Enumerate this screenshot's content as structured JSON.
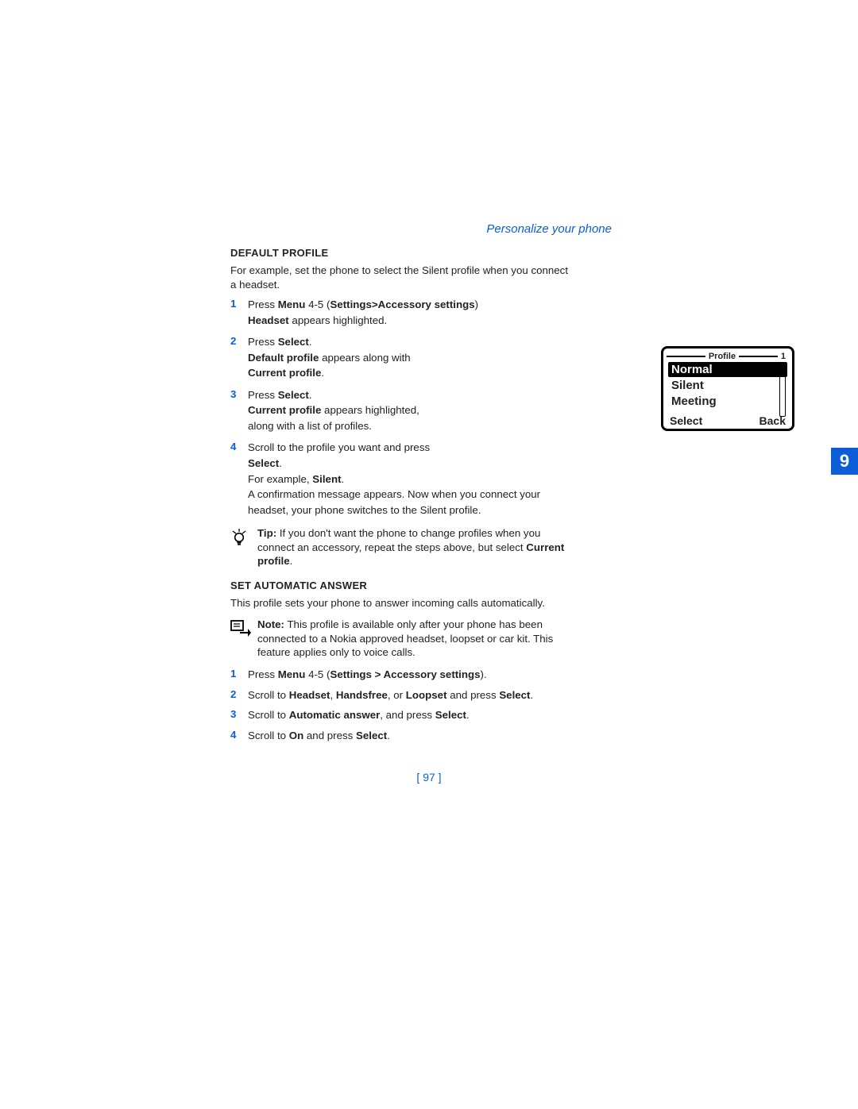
{
  "header": {
    "chapter_title": "Personalize your phone"
  },
  "section_tab": "9",
  "default_profile": {
    "heading": "DEFAULT PROFILE",
    "intro_a": "For example, set the phone to select the Silent profile when you connect",
    "intro_b": "a headset.",
    "steps": {
      "s1": {
        "num": "1",
        "t1a": "Press ",
        "t1b": "Menu",
        "t1c": " 4-5 (",
        "t1d": "Settings>Accessory settings",
        "t1e": ")",
        "t2a": "Headset",
        "t2b": " appears highlighted."
      },
      "s2": {
        "num": "2",
        "t1a": "Press ",
        "t1b": "Select",
        "t1c": ".",
        "t2a": "Default profile",
        "t2b": " appears along with",
        "t3a": "Current profile",
        "t3b": "."
      },
      "s3": {
        "num": "3",
        "t1a": "Press ",
        "t1b": "Select",
        "t1c": ".",
        "t2a": "Current profile",
        "t2b": " appears highlighted,",
        "t3": "along with a list of profiles."
      },
      "s4": {
        "num": "4",
        "t1": "Scroll to the profile you want and press",
        "t2": "Select",
        "t2b": ".",
        "t3a": "For example, ",
        "t3b": "Silent",
        "t3c": ".",
        "t4": "A confirmation message appears. Now when you connect your",
        "t5": "headset, your phone switches to the Silent profile."
      }
    },
    "tip": {
      "lead": "Tip:",
      "t1": " If you don't want the phone to change profiles when you",
      "t2a": "connect an accessory, repeat the steps above, but select ",
      "t2b": "Current",
      "t3a": "profile",
      "t3b": "."
    }
  },
  "phone_screen": {
    "title": "Profile",
    "page": "1",
    "items": {
      "i0": "Normal",
      "i1": "Silent",
      "i2": "Meeting"
    },
    "soft_left": "Select",
    "soft_right": "Back"
  },
  "auto_answer": {
    "heading": "SET AUTOMATIC ANSWER",
    "intro": "This profile sets your phone to answer incoming calls automatically.",
    "note": {
      "lead": "Note:",
      "t1": " This profile is available only after your phone has been",
      "t2": "connected to a Nokia approved headset, loopset or car kit. This",
      "t3": "feature applies only to voice calls."
    },
    "steps": {
      "s1": {
        "num": "1",
        "a": "Press ",
        "b": "Menu",
        "c": " 4-5 (",
        "d": "Settings > Accessory settings",
        "e": ")."
      },
      "s2": {
        "num": "2",
        "a": "Scroll to ",
        "b": "Headset",
        "c": ", ",
        "d": "Handsfree",
        "e": ", or ",
        "f": "Loopset",
        "g": " and press ",
        "h": "Select",
        "i": "."
      },
      "s3": {
        "num": "3",
        "a": "Scroll to ",
        "b": "Automatic answer",
        "c": ", and press ",
        "d": "Select",
        "e": "."
      },
      "s4": {
        "num": "4",
        "a": "Scroll to ",
        "b": "On",
        "c": " and press ",
        "d": "Select",
        "e": "."
      }
    }
  },
  "page_number": "[ 97 ]"
}
